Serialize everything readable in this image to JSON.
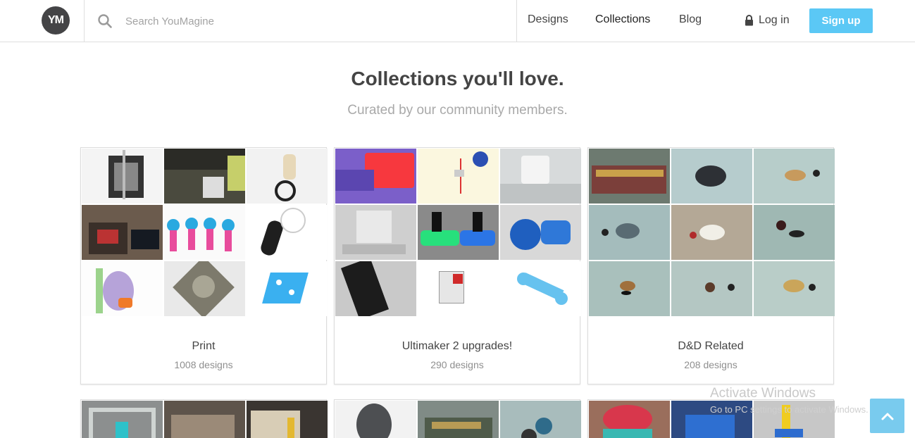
{
  "header": {
    "logo_text": "YM",
    "search_placeholder": "Search YouMagine",
    "nav": [
      {
        "label": "Designs"
      },
      {
        "label": "Collections"
      },
      {
        "label": "Blog"
      }
    ],
    "login_label": "Log in",
    "signup_label": "Sign up"
  },
  "hero": {
    "title": "Collections you'll love.",
    "subtitle": "Curated by our community members."
  },
  "collections": [
    {
      "title": "Print",
      "count": "1008 designs",
      "thumbs": [
        "3d-printer",
        "printer-dark",
        "figure-bike",
        "printer-monitor",
        "pink-figures",
        "headset",
        "spool-holder",
        "dome-part",
        "blue-bracket"
      ]
    },
    {
      "title": "Ultimaker 2 upgrades!",
      "count": "290 designs",
      "thumbs": [
        "red-block",
        "lamp-clock",
        "printer-head",
        "ultimaker-plate",
        "green-mount",
        "blue-fan-duct",
        "black-tube",
        "white-mount",
        "blue-wrench"
      ]
    },
    {
      "title": "D&D Related",
      "count": "208 designs",
      "thumbs": [
        "miniature-army",
        "dark-creature",
        "boar-miniature",
        "rhino-miniature",
        "polar-bear",
        "tiny-creature",
        "deer-miniature",
        "small-miniature",
        "golden-beast"
      ]
    }
  ],
  "watermark": {
    "title": "Activate Windows",
    "subtitle": "Go to PC settings to activate Windows."
  },
  "icons": {
    "search": "search-icon",
    "lock": "lock-icon",
    "to_top": "chevron-up-icon"
  },
  "colors": {
    "accent": "#5bc8f5",
    "logo_bg": "#444446",
    "text": "#444444",
    "muted": "#a9a9a9"
  }
}
